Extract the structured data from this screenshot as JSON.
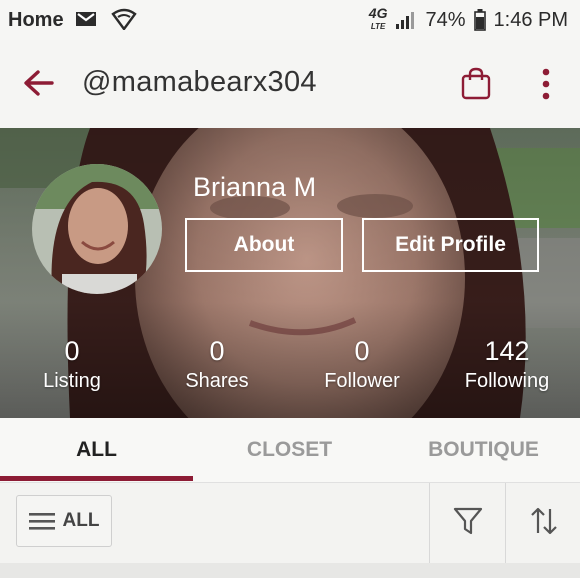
{
  "status_bar": {
    "carrier_label": "Home",
    "network": "4G",
    "network_sub": "LTE",
    "battery": "74%",
    "time": "1:46 PM"
  },
  "app_bar": {
    "handle": "@mamabearx304",
    "back_icon": "arrow-back-icon",
    "bag_icon": "shopping-bag-icon",
    "more_icon": "more-vert-icon",
    "accent_color": "#8d1c35"
  },
  "profile": {
    "name": "Brianna M",
    "about_label": "About",
    "edit_label": "Edit Profile",
    "stats": [
      {
        "value": "0",
        "label": "Listing"
      },
      {
        "value": "0",
        "label": "Shares"
      },
      {
        "value": "0",
        "label": "Follower"
      },
      {
        "value": "142",
        "label": "Following"
      }
    ]
  },
  "tabs": [
    {
      "label": "ALL",
      "active": true
    },
    {
      "label": "CLOSET",
      "active": false
    },
    {
      "label": "BOUTIQUE",
      "active": false
    }
  ],
  "filter_bar": {
    "all_label": "ALL",
    "filter_icon": "filter-funnel-icon",
    "sort_icon": "sort-arrows-icon"
  }
}
